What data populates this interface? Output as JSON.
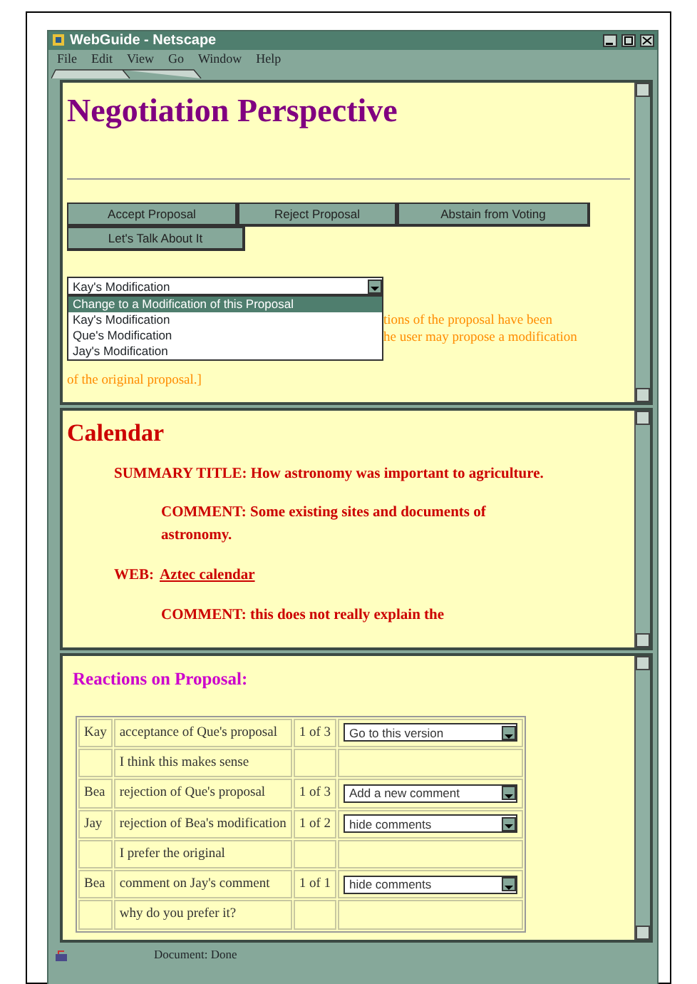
{
  "window": {
    "title": "WebGuide - Netscape"
  },
  "menu": [
    "File",
    "Edit",
    "View",
    "Go",
    "Window",
    "Help"
  ],
  "negotiation": {
    "title": "Negotiation Perspective",
    "buttons": [
      "Accept Proposal",
      "Reject Proposal",
      "Abstain from Voting",
      "Let's Talk About It"
    ],
    "select": {
      "value": "Kay's Modification",
      "expanded": true,
      "options": [
        {
          "label": "Change to a Modification of this Proposal",
          "highlighted": true
        },
        {
          "label": "Kay's Modification",
          "highlighted": false
        },
        {
          "label": "Que's Modification",
          "highlighted": false
        },
        {
          "label": "Jay's Modification",
          "highlighted": false
        }
      ]
    },
    "note_lines": [
      "tions of the proposal have been",
      "he user may propose a modification",
      "of the original proposal.]"
    ]
  },
  "calendar": {
    "title": "Calendar",
    "summary": "SUMMARY TITLE: How astronomy was important to agriculture.",
    "comment": "COMMENT: Some existing sites and documents of astronomy.",
    "web_label": "WEB:",
    "web_link": "Aztec calendar",
    "comment_2": "COMMENT: this does not really explain the"
  },
  "reactions": {
    "title": "Reactions on Proposal:",
    "rows": [
      {
        "author": "Kay",
        "text": "acceptance of Que's proposal",
        "count": "1 of 3",
        "action": "Go to this version"
      },
      {
        "text": "I think this makes sense"
      },
      {
        "author": "Bea",
        "text": "rejection of Que's proposal",
        "count": "1 of 3",
        "action": "Add a new comment"
      },
      {
        "author": "Jay",
        "text": "rejection of Bea's modification",
        "count": "1 of 2",
        "action": "hide comments"
      },
      {
        "text": "I prefer the original"
      },
      {
        "author": "Bea",
        "text": "comment on Jay's comment",
        "count": "1 of 1",
        "action": "hide comments"
      },
      {
        "text": "why do you prefer it?"
      }
    ]
  },
  "status": "Document: Done"
}
